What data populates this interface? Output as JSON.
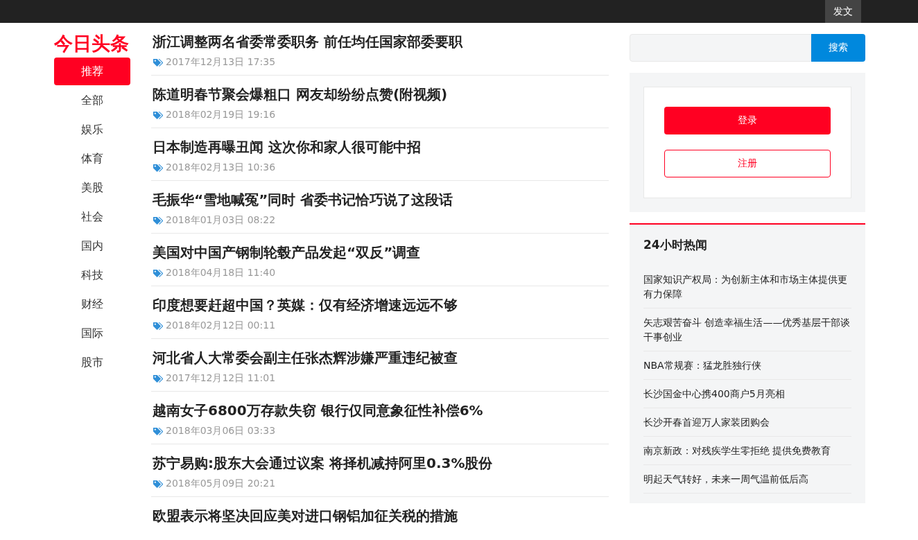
{
  "top_bar": {
    "post_button": "发文"
  },
  "logo": "今日头条",
  "nav": [
    {
      "label": "推荐",
      "selected": true
    },
    {
      "label": "全部",
      "selected": false
    },
    {
      "label": "娱乐",
      "selected": false
    },
    {
      "label": "体育",
      "selected": false
    },
    {
      "label": "美股",
      "selected": false
    },
    {
      "label": "社会",
      "selected": false
    },
    {
      "label": "国内",
      "selected": false
    },
    {
      "label": "科技",
      "selected": false
    },
    {
      "label": "财经",
      "selected": false
    },
    {
      "label": "国际",
      "selected": false
    },
    {
      "label": "股市",
      "selected": false
    }
  ],
  "articles": [
    {
      "title": "浙江调整两名省委常委职务 前任均任国家部委要职",
      "time": "2017年12月13日 17:35"
    },
    {
      "title": "陈道明春节聚会爆粗口 网友却纷纷点赞(附视频)",
      "time": "2018年02月19日 19:16"
    },
    {
      "title": "日本制造再曝丑闻 这次你和家人很可能中招",
      "time": "2018年02月13日 10:36"
    },
    {
      "title": "毛振华“雪地喊冤”同时 省委书记恰巧说了这段话",
      "time": "2018年01月03日 08:22"
    },
    {
      "title": "美国对中国产钢制轮毂产品发起“双反”调查",
      "time": "2018年04月18日 11:40"
    },
    {
      "title": "印度想要赶超中国？英媒：仅有经济增速远远不够",
      "time": "2018年02月12日 00:11"
    },
    {
      "title": "河北省人大常委会副主任张杰辉涉嫌严重违纪被查",
      "time": "2017年12月12日 11:01"
    },
    {
      "title": "越南女子6800万存款失窃 银行仅同意象征性补偿6%",
      "time": "2018年03月06日 03:33"
    },
    {
      "title": "苏宁易购:股东大会通过议案 将择机减持阿里0.3%股份",
      "time": "2018年05月09日 20:21"
    },
    {
      "title": "欧盟表示将坚决回应美对进口钢铝加征关税的措施"
    }
  ],
  "search": {
    "button": "搜索"
  },
  "account": {
    "login": "登录",
    "register": "注册"
  },
  "hot_news": {
    "title": "24小时热闻",
    "items": [
      "国家知识产权局：为创新主体和市场主体提供更有力保障",
      "矢志艰苦奋斗 创造幸福生活——优秀基层干部谈干事创业",
      "NBA常规赛：猛龙胜独行侠",
      "长沙国金中心携400商户5月亮相",
      "长沙开春首迎万人家装团购会",
      "南京新政：对残疾学生零拒绝 提供免费教育",
      "明起天气转好，未来一周气温前低后高"
    ]
  }
}
